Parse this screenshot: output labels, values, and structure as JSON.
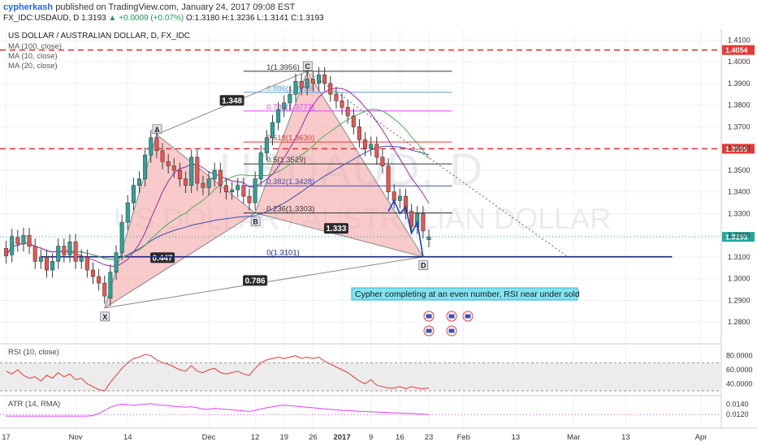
{
  "header": {
    "username": "cypherkash",
    "published_text": "published on TradingView.com, January 24, 2017 09:08 EST",
    "symbol_line": "FX_IDC:USDAUD, D 1.3193",
    "change": "+0.0009 (+0.07%)",
    "ohlc": "O:1.3180 H:1.3236 L:1.3141 C:1.3193"
  },
  "chart_title": "US DOLLAR / AUSTRALIAN DOLLAR, D, FX_IDC",
  "legend": [
    "MA (100, close)",
    "MA (10, close)",
    "MA (20, close)"
  ],
  "watermark": {
    "symbol": "USDAUD, D",
    "name": "US DOLLAR / AUSTRALIAN DOLLAR"
  },
  "colors": {
    "up": "#26a69a",
    "down": "#ef5350",
    "pattern_fill": "#f4a7a7",
    "resistance": "#e53935",
    "ma100": "#3f51b5",
    "ma10": "#9c27b0",
    "ma20": "#4caf50",
    "support": "#1a237e",
    "rsi": "#e53935",
    "atr": "#e040fb"
  },
  "chart_data": {
    "type": "candlestick",
    "price_axis": {
      "min": 1.27,
      "max": 1.415,
      "ticks": [
        "1.4100",
        "1.4000",
        "1.3900",
        "1.3800",
        "1.3700",
        "1.3600",
        "1.3500",
        "1.3400",
        "1.3300",
        "1.3200",
        "1.3100",
        "1.3000",
        "1.2900",
        "1.2800"
      ]
    },
    "time_axis": {
      "labels": [
        {
          "label": "17",
          "bar": 0
        },
        {
          "label": "Nov",
          "bar": 12
        },
        {
          "label": "14",
          "bar": 21
        },
        {
          "label": "Dec",
          "bar": 35
        },
        {
          "label": "12",
          "bar": 43
        },
        {
          "label": "19",
          "bar": 48
        },
        {
          "label": "26",
          "bar": 53
        },
        {
          "label": "2017",
          "bar": 58
        },
        {
          "label": "9",
          "bar": 63
        },
        {
          "label": "16",
          "bar": 68
        },
        {
          "label": "23",
          "bar": 73
        },
        {
          "label": "Feb",
          "bar": 79
        },
        {
          "label": "13",
          "bar": 88
        },
        {
          "label": "Mar",
          "bar": 98
        },
        {
          "label": "13",
          "bar": 107
        },
        {
          "label": "Apr",
          "bar": 120
        }
      ],
      "bars_visible": 124
    },
    "closes": [
      1.3105,
      1.3195,
      1.316,
      1.32,
      1.315,
      1.308,
      1.31,
      1.304,
      1.308,
      1.315,
      1.311,
      1.317,
      1.308,
      1.31,
      1.304,
      1.301,
      1.298,
      1.292,
      1.303,
      1.312,
      1.326,
      1.335,
      1.343,
      1.346,
      1.357,
      1.365,
      1.359,
      1.354,
      1.352,
      1.35,
      1.346,
      1.343,
      1.356,
      1.344,
      1.342,
      1.346,
      1.35,
      1.343,
      1.34,
      1.341,
      1.343,
      1.338,
      1.335,
      1.346,
      1.358,
      1.365,
      1.372,
      1.378,
      1.381,
      1.385,
      1.391,
      1.388,
      1.392,
      1.39,
      1.394,
      1.39,
      1.385,
      1.382,
      1.379,
      1.375,
      1.37,
      1.364,
      1.36,
      1.362,
      1.356,
      1.352,
      1.34,
      1.336,
      1.338,
      1.331,
      1.324,
      1.33,
      1.322,
      1.3193
    ],
    "opens": [
      1.314,
      1.311,
      1.319,
      1.316,
      1.32,
      1.315,
      1.308,
      1.31,
      1.304,
      1.308,
      1.315,
      1.311,
      1.317,
      1.308,
      1.31,
      1.304,
      1.301,
      1.298,
      1.291,
      1.303,
      1.312,
      1.326,
      1.335,
      1.343,
      1.346,
      1.357,
      1.365,
      1.359,
      1.354,
      1.352,
      1.35,
      1.346,
      1.343,
      1.356,
      1.344,
      1.342,
      1.346,
      1.35,
      1.343,
      1.34,
      1.341,
      1.343,
      1.338,
      1.335,
      1.346,
      1.358,
      1.365,
      1.372,
      1.378,
      1.381,
      1.385,
      1.391,
      1.388,
      1.392,
      1.39,
      1.394,
      1.39,
      1.385,
      1.382,
      1.379,
      1.375,
      1.37,
      1.364,
      1.36,
      1.362,
      1.356,
      1.352,
      1.34,
      1.336,
      1.338,
      1.331,
      1.324,
      1.33,
      1.318
    ],
    "pattern_points": [
      {
        "label": "X",
        "bar": 17,
        "price": 1.2865
      },
      {
        "label": "A",
        "bar": 26,
        "price": 1.3665
      },
      {
        "label": "B",
        "bar": 43,
        "price": 1.3303
      },
      {
        "label": "C",
        "bar": 52,
        "price": 1.3956
      },
      {
        "label": "D",
        "bar": 72,
        "price": 1.3101
      }
    ],
    "pattern_ratios": [
      {
        "text": "1.348",
        "bar": 39,
        "price": 1.382
      },
      {
        "text": "0.447",
        "bar": 27,
        "price": 1.3095
      },
      {
        "text": "0.786",
        "bar": 43,
        "price": 1.299
      },
      {
        "text": "1.333",
        "bar": 57,
        "price": 1.323
      }
    ],
    "fib_levels": [
      {
        "ratio": "1",
        "label": "1(1.3956)",
        "price": 1.3956,
        "color": "#333333"
      },
      {
        "ratio": "0.886",
        "label": "0.886(1.3859)",
        "price": 1.3859,
        "color": "#5b9bd5"
      },
      {
        "ratio": "0.786",
        "label": "0.786(1.3773)",
        "price": 1.3773,
        "color": "#e040fb"
      },
      {
        "ratio": "0.618",
        "label": "0.618(1.3630)",
        "price": 1.363,
        "color": "#e53935"
      },
      {
        "ratio": "0.5",
        "label": "0.5(1.3529)",
        "price": 1.3529,
        "color": "#333333"
      },
      {
        "ratio": "0.382",
        "label": "0.382(1.3428)",
        "price": 1.3428,
        "color": "#3f51b5"
      },
      {
        "ratio": "0.236",
        "label": "0.236(1.3303)",
        "price": 1.3303,
        "color": "#333333"
      },
      {
        "ratio": "0",
        "label": "0(1.3101)",
        "price": 1.3101,
        "color": "#1a237e"
      }
    ],
    "resistance_lines": [
      1.4054,
      1.3599
    ],
    "price_badges": [
      {
        "text": "1.4054",
        "price": 1.4054,
        "color": "#e53935"
      },
      {
        "text": "1.3599",
        "price": 1.3599,
        "color": "#e53935"
      },
      {
        "text": "1.3193",
        "price": 1.3193,
        "color": "#26a69a"
      }
    ],
    "annotation": "Cypher completing at an even number, RSI near under sold",
    "rsi": {
      "label": "RSI (10, close)",
      "ticks": [
        "80.0000",
        "60.0000",
        "40.0000"
      ],
      "min": 30,
      "max": 90,
      "band": [
        30,
        70
      ],
      "values": [
        58,
        54,
        60,
        52,
        48,
        50,
        44,
        52,
        48,
        56,
        50,
        54,
        46,
        48,
        40,
        36,
        32,
        30,
        42,
        52,
        62,
        70,
        76,
        78,
        82,
        80,
        74,
        70,
        68,
        64,
        60,
        58,
        66,
        58,
        56,
        60,
        62,
        56,
        54,
        56,
        58,
        54,
        52,
        62,
        70,
        74,
        76,
        78,
        76,
        78,
        80,
        76,
        78,
        76,
        78,
        72,
        68,
        64,
        60,
        56,
        50,
        44,
        40,
        46,
        38,
        36,
        34,
        34,
        36,
        33,
        36,
        34,
        33,
        34
      ]
    },
    "atr": {
      "label": "ATR (14, RMA)",
      "ticks": [
        "0.0140",
        "0.0120"
      ],
      "min": 0.01,
      "max": 0.015,
      "baseline": 0.012,
      "values": [
        0.0117,
        0.0117,
        0.0117,
        0.0117,
        0.0117,
        0.0117,
        0.0117,
        0.0117,
        0.0117,
        0.0117,
        0.0117,
        0.0117,
        0.0117,
        0.0117,
        0.0117,
        0.0118,
        0.0122,
        0.0128,
        0.0134,
        0.0138,
        0.014,
        0.0139,
        0.0138,
        0.0139,
        0.014,
        0.0141,
        0.0139,
        0.0138,
        0.0137,
        0.0136,
        0.0135,
        0.0134,
        0.0135,
        0.0133,
        0.0131,
        0.013,
        0.0132,
        0.0131,
        0.013,
        0.0129,
        0.0128,
        0.0127,
        0.0126,
        0.0128,
        0.0131,
        0.0133,
        0.0135,
        0.0137,
        0.0138,
        0.0137,
        0.0136,
        0.0135,
        0.0134,
        0.0133,
        0.0132,
        0.0131,
        0.013,
        0.0129,
        0.0128,
        0.0128,
        0.0127,
        0.0126,
        0.0126,
        0.0125,
        0.0125,
        0.0124,
        0.0124,
        0.0123,
        0.0123,
        0.0122,
        0.0122,
        0.0121,
        0.0121,
        0.012
      ]
    }
  }
}
